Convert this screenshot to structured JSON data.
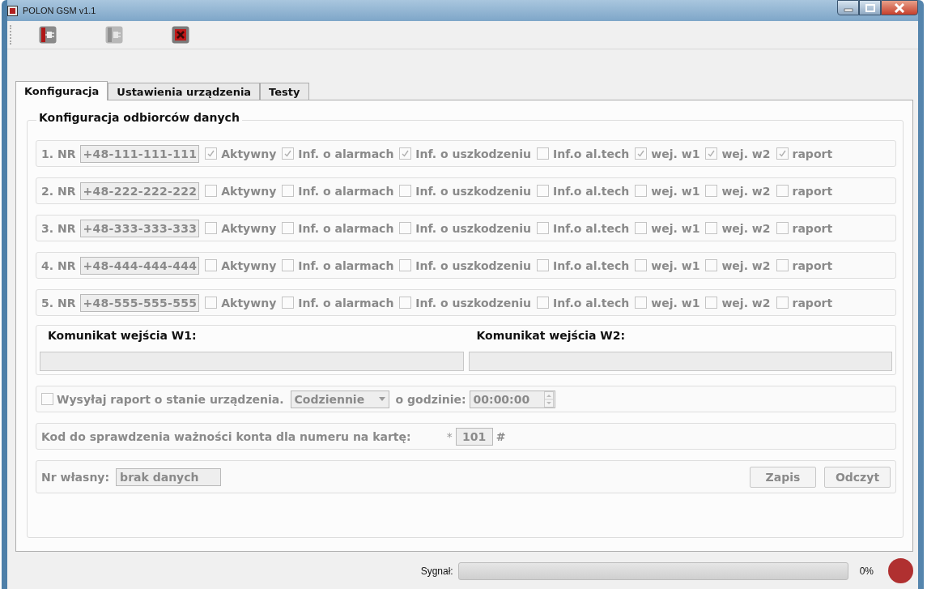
{
  "window": {
    "title": "POLON GSM v1.1"
  },
  "toolbar": [
    {
      "kind": "connect"
    },
    {
      "kind": "disconnect"
    },
    {
      "kind": "close"
    }
  ],
  "tabs": [
    {
      "label": "Konfiguracja",
      "selected": true
    },
    {
      "label": "Ustawienia urządzenia",
      "selected": false
    },
    {
      "label": "Testy",
      "selected": false
    }
  ],
  "group": {
    "title": "Konfiguracja odbiorców danych",
    "recipients": [
      {
        "label": "1. NR",
        "number": "+48-111-111-111",
        "options": [
          {
            "label": "Aktywny",
            "checked": true
          },
          {
            "label": "Inf. o alarmach",
            "checked": true
          },
          {
            "label": "Inf. o uszkodzeniu",
            "checked": true
          },
          {
            "label": "Inf.o al.tech",
            "checked": false
          },
          {
            "label": "wej. w1",
            "checked": true
          },
          {
            "label": "wej. w2",
            "checked": true
          },
          {
            "label": "raport",
            "checked": true
          }
        ]
      },
      {
        "label": "2. NR",
        "number": "+48-222-222-222",
        "options": [
          {
            "label": "Aktywny",
            "checked": false
          },
          {
            "label": "Inf. o alarmach",
            "checked": false
          },
          {
            "label": "Inf. o uszkodzeniu",
            "checked": false
          },
          {
            "label": "Inf.o al.tech",
            "checked": false
          },
          {
            "label": "wej. w1",
            "checked": false
          },
          {
            "label": "wej. w2",
            "checked": false
          },
          {
            "label": "raport",
            "checked": false
          }
        ]
      },
      {
        "label": "3. NR",
        "number": "+48-333-333-333",
        "options": [
          {
            "label": "Aktywny",
            "checked": false
          },
          {
            "label": "Inf. o alarmach",
            "checked": false
          },
          {
            "label": "Inf. o uszkodzeniu",
            "checked": false
          },
          {
            "label": "Inf.o al.tech",
            "checked": false
          },
          {
            "label": "wej. w1",
            "checked": false
          },
          {
            "label": "wej. w2",
            "checked": false
          },
          {
            "label": "raport",
            "checked": false
          }
        ]
      },
      {
        "label": "4. NR",
        "number": "+48-444-444-444",
        "options": [
          {
            "label": "Aktywny",
            "checked": false
          },
          {
            "label": "Inf. o alarmach",
            "checked": false
          },
          {
            "label": "Inf. o uszkodzeniu",
            "checked": false
          },
          {
            "label": "Inf.o al.tech",
            "checked": false
          },
          {
            "label": "wej. w1",
            "checked": false
          },
          {
            "label": "wej. w2",
            "checked": false
          },
          {
            "label": "raport",
            "checked": false
          }
        ]
      },
      {
        "label": "5. NR",
        "number": "+48-555-555-555",
        "options": [
          {
            "label": "Aktywny",
            "checked": false
          },
          {
            "label": "Inf. o alarmach",
            "checked": false
          },
          {
            "label": "Inf. o uszkodzeniu",
            "checked": false
          },
          {
            "label": "Inf.o al.tech",
            "checked": false
          },
          {
            "label": "wej. w1",
            "checked": false
          },
          {
            "label": "wej. w2",
            "checked": false
          },
          {
            "label": "raport",
            "checked": false
          }
        ]
      }
    ],
    "messages": [
      {
        "title": "Komunikat wejścia W1:"
      },
      {
        "title": "Komunikat wejścia W2:"
      }
    ],
    "report": {
      "checked": false,
      "label": "Wysyłaj raport o stanie urządzenia.",
      "frequency": "Codziennie",
      "time_label": "o godzinie:",
      "time": "00:00:00"
    },
    "account_code": {
      "label": "Kod do sprawdzenia ważności konta dla numeru na kartę:",
      "prefix": "*",
      "code": "101",
      "suffix": "#"
    },
    "own_number": {
      "label": "Nr własny:",
      "value": "brak danych"
    },
    "buttons": [
      "Zapis",
      "Odczyt"
    ]
  },
  "status_bar": {
    "signal_label": "Sygnał:",
    "level": 0,
    "reading": "0%",
    "connected": false
  }
}
